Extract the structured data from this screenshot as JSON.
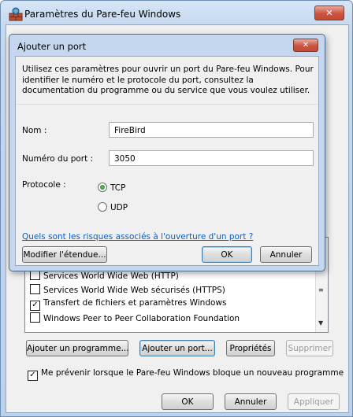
{
  "window": {
    "title": "Paramètres du Pare-feu Windows",
    "close_glyph": "✕"
  },
  "exceptions_list": {
    "items": [
      {
        "label": "Services World Wide Web (HTTP)",
        "checked": false
      },
      {
        "label": "Services World Wide Web sécurisés (HTTPS)",
        "checked": false
      },
      {
        "label": "Transfert de fichiers et paramètres Windows",
        "checked": true
      },
      {
        "label": "Windows Peer to Peer Collaboration Foundation",
        "checked": false
      }
    ]
  },
  "buttons": {
    "add_program": "Ajouter un programme...",
    "add_port": "Ajouter un port...",
    "properties": "Propriétés",
    "delete": "Supprimer",
    "ok": "OK",
    "cancel": "Annuler",
    "apply": "Appliquer"
  },
  "notify": {
    "label": "Me prévenir lorsque le Pare-feu Windows bloque un nouveau programme",
    "checked": true
  },
  "dialog": {
    "title": "Ajouter un port",
    "close_glyph": "✕",
    "description": "Utilisez ces paramètres pour ouvrir un port du Pare-feu Windows. Pour identifier le numéro et le protocole du port, consultez la documentation du programme ou du service que vous voulez utiliser.",
    "name_label": "Nom :",
    "name_value": "FireBird",
    "port_label": "Numéro du port :",
    "port_value": "3050",
    "protocol_label": "Protocole :",
    "protocol_options": [
      "TCP",
      "UDP"
    ],
    "protocol_selected": "TCP",
    "risk_link": "Quels sont les risques associés à l'ouverture d'un port ?",
    "change_scope": "Modifier l'étendue...",
    "ok": "OK",
    "cancel": "Annuler"
  }
}
